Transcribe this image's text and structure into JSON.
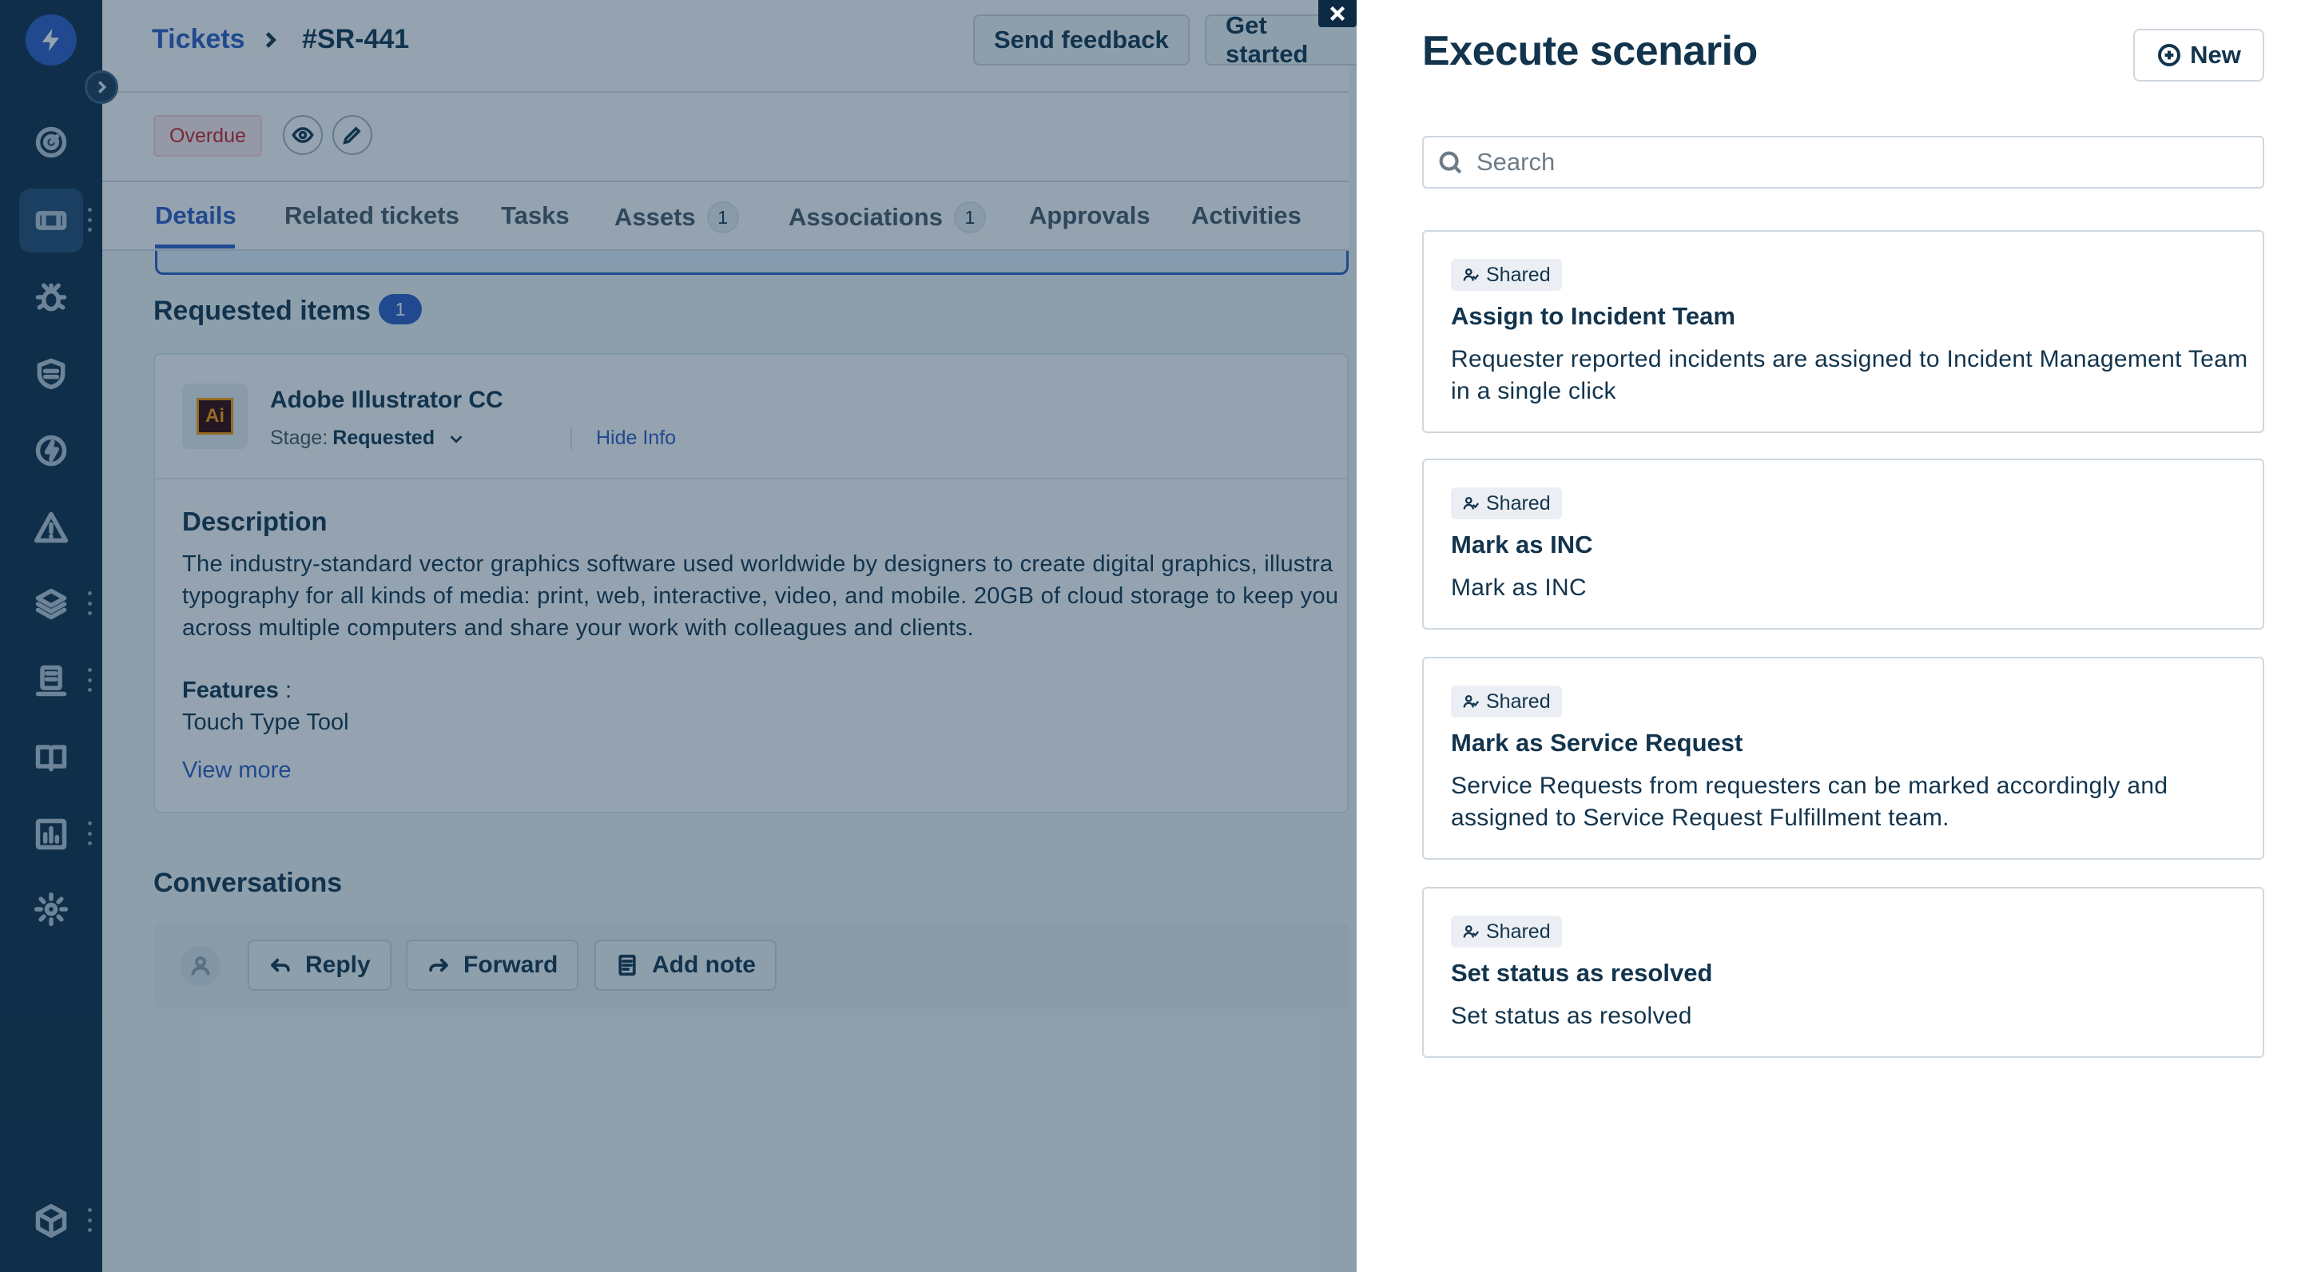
{
  "breadcrumb": {
    "parent": "Tickets",
    "current": "#SR-441"
  },
  "topbar": {
    "feedback_label": "Send feedback",
    "get_started_label": "Get started"
  },
  "status": {
    "overdue_label": "Overdue"
  },
  "tabs": [
    {
      "label": "Details",
      "count": null
    },
    {
      "label": "Related tickets",
      "count": null
    },
    {
      "label": "Tasks",
      "count": null
    },
    {
      "label": "Assets",
      "count": "1"
    },
    {
      "label": "Associations",
      "count": "1"
    },
    {
      "label": "Approvals",
      "count": null
    },
    {
      "label": "Activities",
      "count": null
    }
  ],
  "requested_items": {
    "title": "Requested items",
    "count": "1",
    "item": {
      "logo_text": "Ai",
      "name": "Adobe Illustrator CC",
      "stage_label": "Stage:",
      "stage_value": "Requested",
      "hide_info_label": "Hide Info",
      "description_title": "Description",
      "description_text": "The industry-standard vector graphics software used worldwide by designers to create digital graphics, illustra\ntypography for all kinds of media: print, web, interactive, video, and mobile. 20GB of cloud storage to keep you\nacross multiple computers and share your work with colleagues and clients.",
      "features_label": "Features",
      "features_sep": " :",
      "features_value": "Touch Type Tool",
      "view_more_label": "View more"
    }
  },
  "conversations": {
    "title": "Conversations",
    "reply_label": "Reply",
    "forward_label": "Forward",
    "add_note_label": "Add note"
  },
  "drawer": {
    "title": "Execute scenario",
    "new_label": "New",
    "search_placeholder": "Search",
    "scenarios": [
      {
        "tag": "Shared",
        "name": "Assign to Incident Team",
        "description": "Requester reported incidents are assigned to Incident Management Team in a single click"
      },
      {
        "tag": "Shared",
        "name": "Mark as INC",
        "description": "Mark as INC"
      },
      {
        "tag": "Shared",
        "name": "Mark as Service Request",
        "description": "Service Requests from requesters can be marked accordingly and assigned to Service Request Fulfillment team."
      },
      {
        "tag": "Shared",
        "name": "Set status as resolved",
        "description": "Set status as resolved"
      }
    ]
  },
  "colors": {
    "accent": "#2c5cc5",
    "rail": "#0d2a45",
    "danger": "#c82124"
  },
  "icons": {
    "rail": [
      "logo-bolt-icon",
      "dashboard-icon",
      "tickets-icon",
      "bug-icon",
      "shield-icon",
      "changes-icon",
      "alert-icon",
      "layers-icon",
      "assets-icon",
      "book-icon",
      "reports-icon",
      "settings-icon",
      "box-icon"
    ]
  }
}
